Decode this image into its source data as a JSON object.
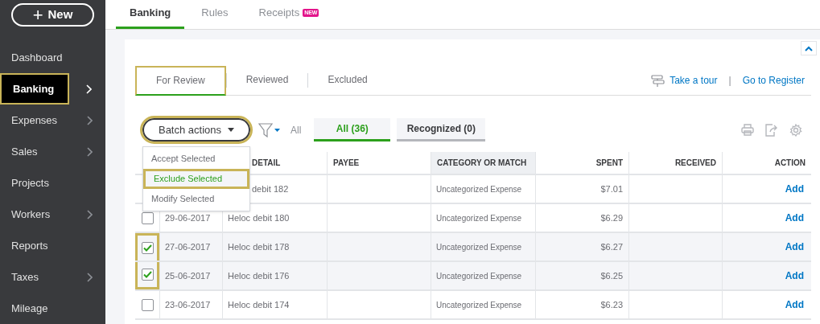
{
  "sidebar": {
    "new_button": {
      "icon": "+",
      "label": "New"
    },
    "items": [
      {
        "label": "Dashboard",
        "selected": false,
        "chevron": false,
        "highlighted": false
      },
      {
        "label": "Banking",
        "selected": true,
        "chevron": true,
        "highlighted": true
      },
      {
        "label": "Expenses",
        "selected": false,
        "chevron": true,
        "highlighted": false
      },
      {
        "label": "Sales",
        "selected": false,
        "chevron": true,
        "highlighted": false
      },
      {
        "label": "Projects",
        "selected": false,
        "chevron": false,
        "highlighted": false
      },
      {
        "label": "Workers",
        "selected": false,
        "chevron": true,
        "highlighted": false
      },
      {
        "label": "Reports",
        "selected": false,
        "chevron": false,
        "highlighted": false
      },
      {
        "label": "Taxes",
        "selected": false,
        "chevron": true,
        "highlighted": false
      },
      {
        "label": "Mileage",
        "selected": false,
        "chevron": false,
        "highlighted": false
      }
    ]
  },
  "top_tabs": [
    {
      "label": "Banking",
      "selected": true
    },
    {
      "label": "Rules",
      "selected": false
    },
    {
      "label": "Receipts",
      "selected": false,
      "badge": "NEW"
    }
  ],
  "sub_tabs": [
    {
      "label": "For Review",
      "selected": true,
      "highlighted": true
    },
    {
      "label": "Reviewed",
      "selected": false,
      "highlighted": false
    },
    {
      "label": "Excluded",
      "selected": false,
      "highlighted": false
    }
  ],
  "links": {
    "tour": "Take a tour",
    "separator": "|",
    "register": "Go to Register"
  },
  "toolbar": {
    "batch_button": {
      "label": "Batch actions",
      "highlighted": true
    },
    "filter_label": "All",
    "filter_tabs": [
      {
        "label": "All (36)",
        "selected": true
      },
      {
        "label": "Recognized (0)",
        "selected": false
      }
    ]
  },
  "batch_menu": [
    {
      "label": "Accept Selected",
      "selected": false,
      "highlighted": false
    },
    {
      "label": "Exclude Selected",
      "selected": true,
      "highlighted": true
    },
    {
      "label": "Modify Selected",
      "selected": false,
      "highlighted": false
    }
  ],
  "table": {
    "columns": [
      {
        "label": "DETAIL",
        "sorted": false
      },
      {
        "label": "PAYEE",
        "sorted": false
      },
      {
        "label": "CATEGORY OR MATCH",
        "sorted": true
      },
      {
        "label": "SPENT",
        "sorted": false
      },
      {
        "label": "RECEIVED",
        "sorted": false
      },
      {
        "label": "ACTION",
        "sorted": false
      }
    ],
    "rows": [
      {
        "covered": true,
        "highlighted": false,
        "detail": "debit 182",
        "category": "Uncategorized Expense",
        "spent": "$7.01",
        "action": "Add"
      },
      {
        "covered": false,
        "checked": false,
        "highlighted": false,
        "date": "29-06-2017",
        "detail": "Heloc debit 180",
        "category": "Uncategorized Expense",
        "spent": "$6.29",
        "action": "Add"
      },
      {
        "covered": false,
        "checked": true,
        "highlighted": true,
        "date": "27-06-2017",
        "detail": "Heloc debit 178",
        "category": "Uncategorized Expense",
        "spent": "$6.27",
        "action": "Add"
      },
      {
        "covered": false,
        "checked": true,
        "highlighted": true,
        "date": "25-06-2017",
        "detail": "Heloc debit 176",
        "category": "Uncategorized Expense",
        "spent": "$6.25",
        "action": "Add"
      },
      {
        "covered": false,
        "checked": false,
        "highlighted": false,
        "date": "23-06-2017",
        "detail": "Heloc debit 174",
        "category": "Uncategorized Expense",
        "spent": "$6.23",
        "action": "Add"
      }
    ]
  }
}
